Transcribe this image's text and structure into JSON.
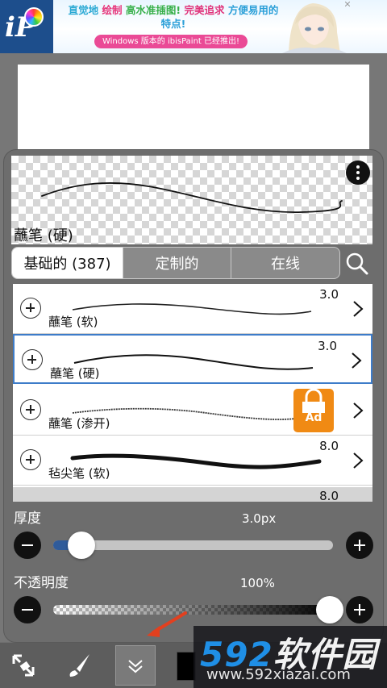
{
  "ad": {
    "line1": {
      "a": "直觉地",
      "b": "绘制",
      "c": "高水准插图!",
      "d": "完美追求",
      "e": "方便易用的"
    },
    "line2": "特点!",
    "pill": "Windows 版本的 ibisPaint 已经推出!",
    "logo": "iP"
  },
  "preview": {
    "title": "蘸笔 (硬)",
    "more_icon": "more-vertical-icon"
  },
  "tabs": [
    {
      "label": "基础的 (387)",
      "active": true
    },
    {
      "label": "定制的",
      "active": false
    },
    {
      "label": "在线",
      "active": false
    }
  ],
  "search_icon": "search-icon",
  "brushes": [
    {
      "name": "蘸笔 (软)",
      "size": "3.0",
      "selected": false,
      "locked": false
    },
    {
      "name": "蘸笔 (硬)",
      "size": "3.0",
      "selected": true,
      "locked": false
    },
    {
      "name": "蘸笔 (渗开)",
      "size": "",
      "selected": false,
      "locked": true,
      "lock_label": "Ad"
    },
    {
      "name": "毡尖笔 (软)",
      "size": "8.0",
      "selected": false,
      "locked": false
    },
    {
      "name": "",
      "size": "8.0",
      "selected": false,
      "locked": false
    }
  ],
  "thickness": {
    "label": "厚度",
    "value": "3.0px",
    "level_percent": 10
  },
  "opacity": {
    "label": "不透明度",
    "value": "100%",
    "level_percent": 100
  },
  "toolbar": {
    "items": [
      "transform-icon",
      "brush-icon",
      "collapse-icon"
    ],
    "color": "#000000"
  },
  "watermark": {
    "digits": "592",
    "text": "软件园",
    "url": "www.592xiazai.com"
  },
  "colors": {
    "selected_border": "#3d7cc9",
    "ad_lock": "#f08a14",
    "watermark_blue": "#1f8fe6"
  }
}
